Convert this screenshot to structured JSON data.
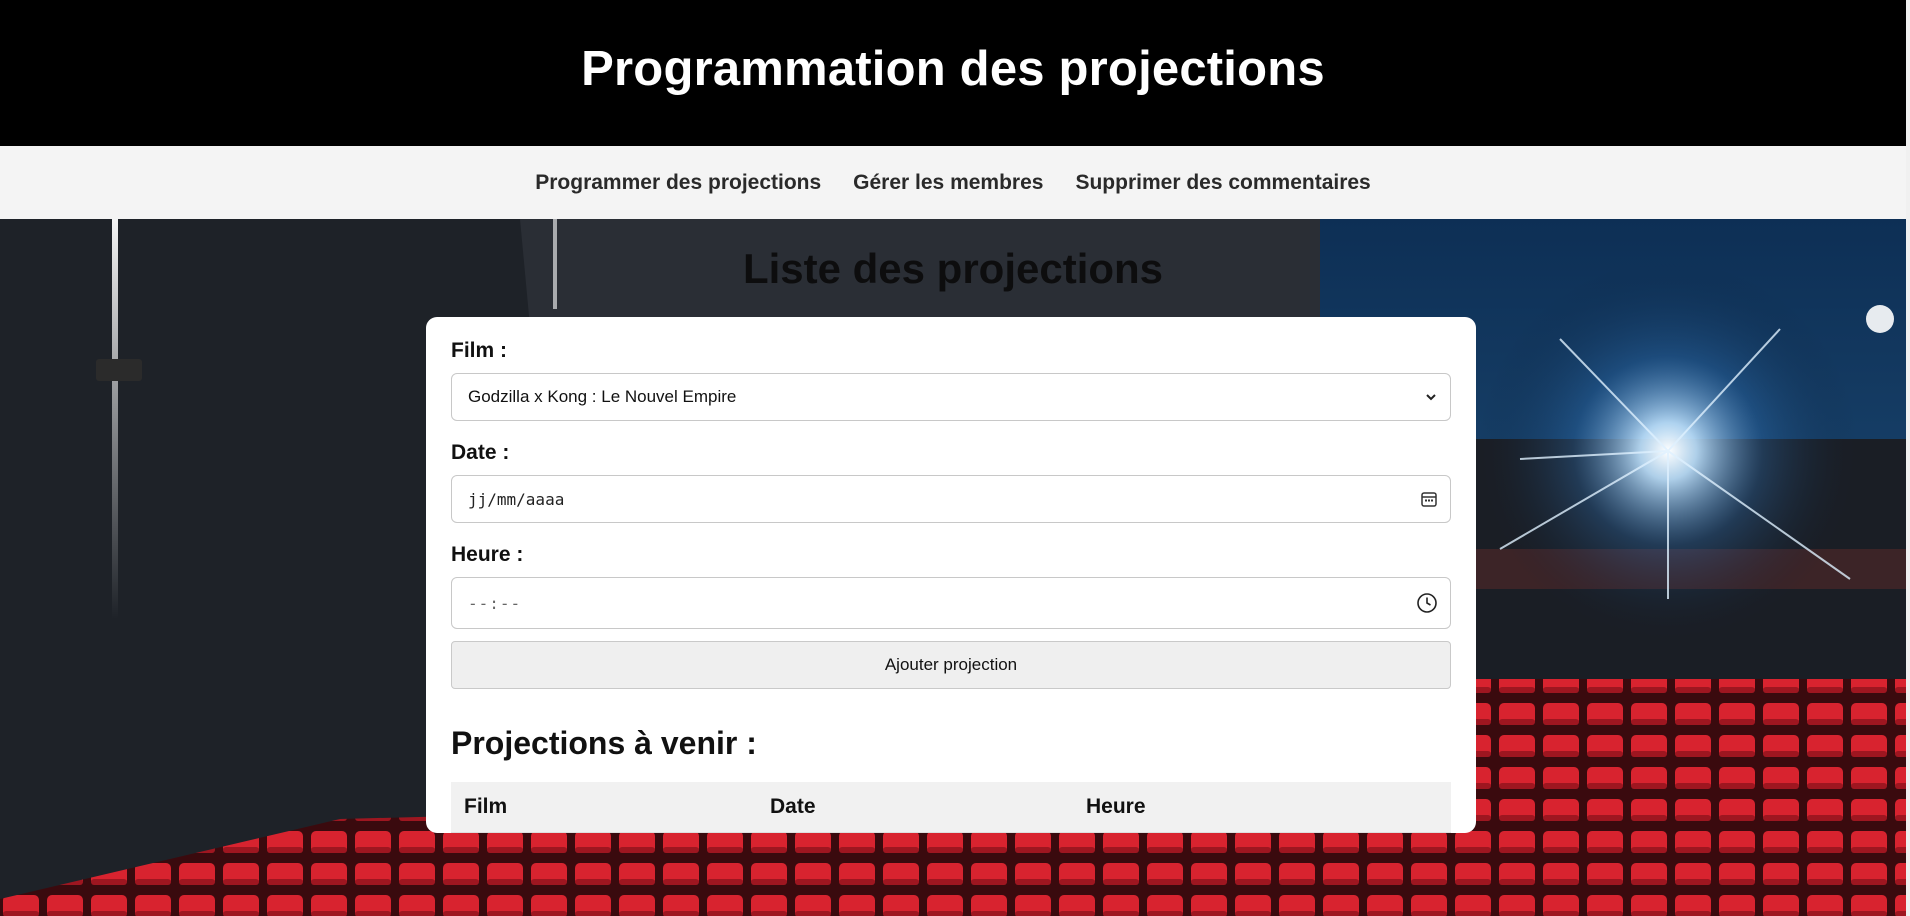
{
  "header": {
    "title": "Programmation des projections"
  },
  "nav": {
    "items": [
      {
        "label": "Programmer des projections"
      },
      {
        "label": "Gérer les membres"
      },
      {
        "label": "Supprimer des commentaires"
      }
    ]
  },
  "main": {
    "section_title": "Liste des projections",
    "form": {
      "film_label": "Film :",
      "film_selected": "Godzilla x Kong : Le Nouvel Empire",
      "date_label": "Date :",
      "date_placeholder": "jj/mm/aaaa",
      "time_label": "Heure :",
      "time_placeholder": "--:--",
      "submit_label": "Ajouter projection"
    },
    "upcoming": {
      "title": "Projections à venir :",
      "columns": [
        "Film",
        "Date",
        "Heure"
      ],
      "rows": []
    }
  },
  "colors": {
    "header_bg": "#000000",
    "nav_bg": "#f4f4f4",
    "seat_red": "#d8232f",
    "projector_blue": "#2f6fb0"
  },
  "icons": {
    "date_field": "calendar-icon",
    "time_field": "clock-icon",
    "select": "chevron-down-icon"
  }
}
